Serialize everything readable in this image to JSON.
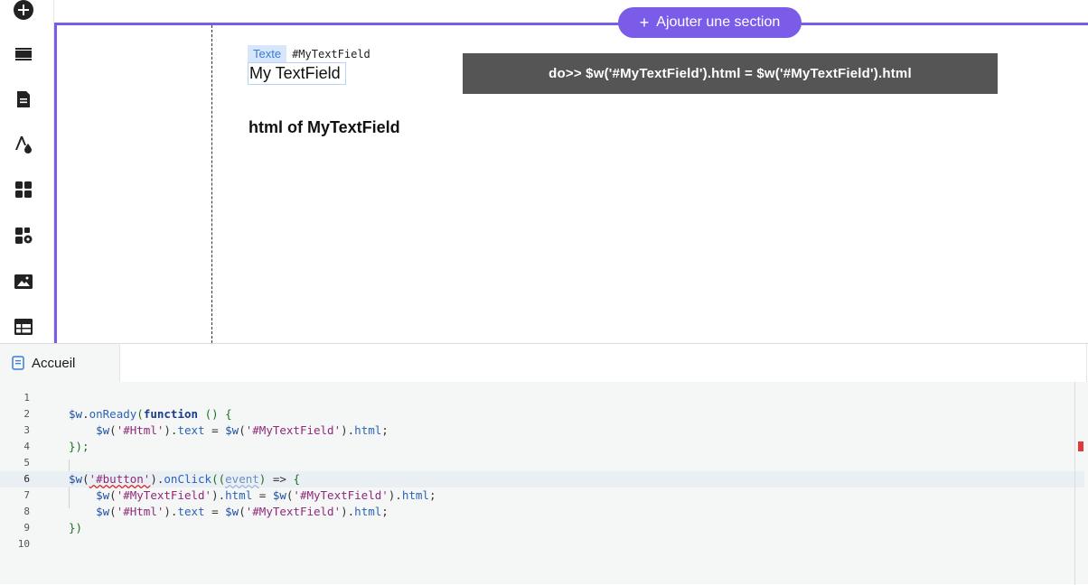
{
  "toolbar": {
    "items": [
      {
        "name": "add-icon"
      },
      {
        "name": "sections-icon"
      },
      {
        "name": "pages-icon"
      },
      {
        "name": "design-icon"
      },
      {
        "name": "apps-icon"
      },
      {
        "name": "business-icon"
      },
      {
        "name": "media-icon"
      },
      {
        "name": "cms-icon"
      }
    ]
  },
  "canvas": {
    "add_section_label": "Ajouter une section",
    "textfield_tag_type": "Texte",
    "textfield_tag_id": "#MyTextField",
    "textfield_value": "My TextField",
    "button_label": "do>> $w('#MyTextField').html = $w('#MyTextField').html",
    "html_text": "html of MyTextField"
  },
  "code_panel": {
    "tab_label": "Accueil",
    "active_line": 6,
    "lines": [
      "1",
      "2",
      "3",
      "4",
      "5",
      "6",
      "7",
      "8",
      "9",
      "10"
    ]
  },
  "colors": {
    "accent": "#7b5ce8",
    "button_bg": "#555555",
    "tag_bg": "#d8e6fb"
  }
}
